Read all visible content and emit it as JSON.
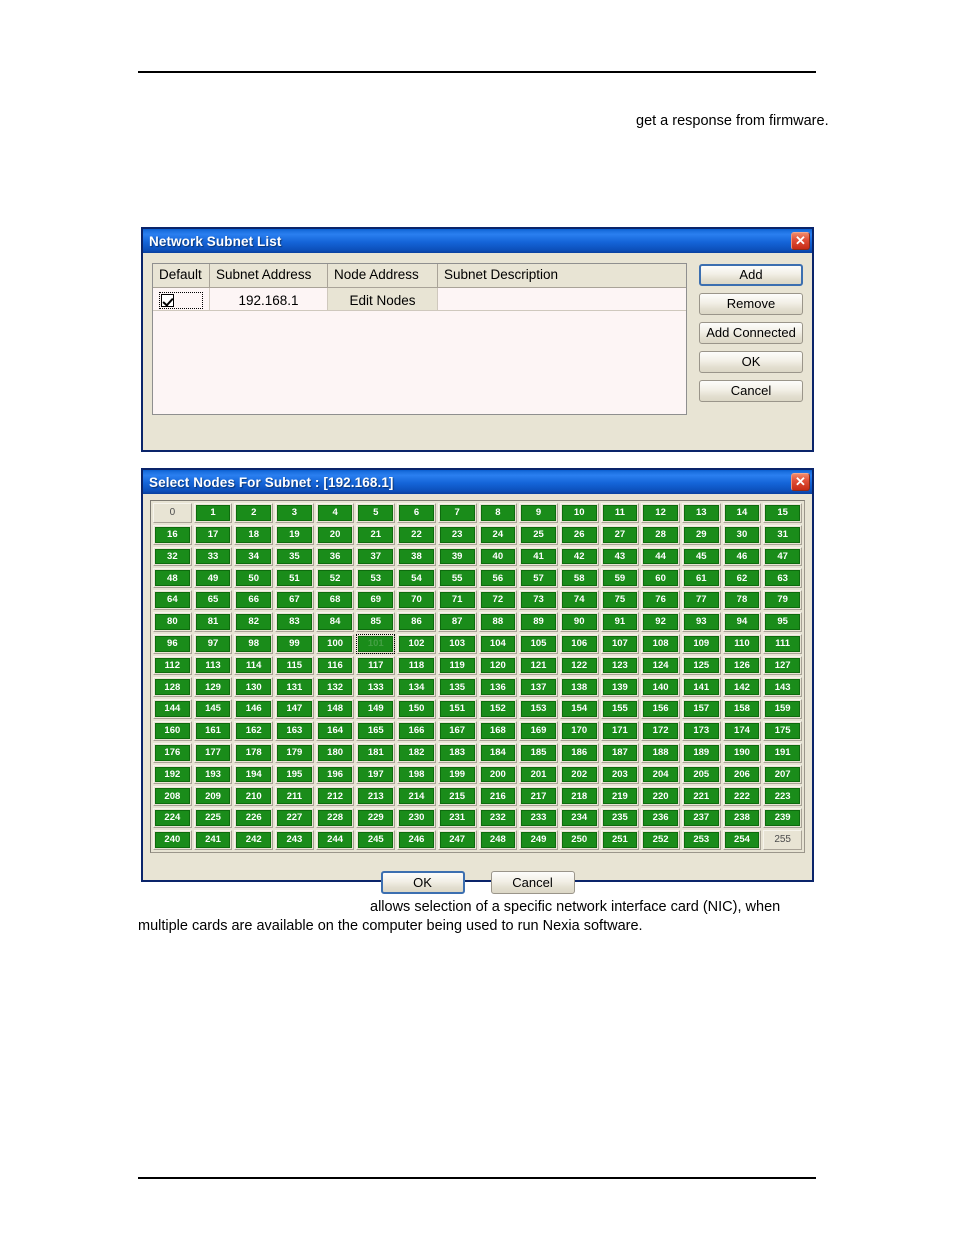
{
  "document": {
    "snippet_top": "get a response from firmware.",
    "body_paragraph": "allows selection of a specific network interface card (NIC), when multiple cards are available on the computer being used to run Nexia software."
  },
  "subnet_dialog": {
    "title": "Network Subnet List",
    "close_icon": "close-icon",
    "close_label": "✕",
    "columns": [
      "Default",
      "Subnet Address",
      "Node Address",
      "Subnet Description"
    ],
    "rows": [
      {
        "default_checked": true,
        "subnet_address": "192.168.1",
        "node_address": "Edit Nodes",
        "description": ""
      }
    ],
    "buttons": [
      {
        "label": "Add",
        "default": true
      },
      {
        "label": "Remove",
        "default": false
      },
      {
        "label": "Add Connected",
        "default": false
      },
      {
        "label": "OK",
        "default": false
      },
      {
        "label": "Cancel",
        "default": false
      }
    ]
  },
  "nodes_dialog": {
    "title": "Select Nodes For Subnet : [192.168.1]",
    "close_icon": "close-icon",
    "close_label": "✕",
    "grid": {
      "columns": 16,
      "rows": 16,
      "first_node": 0,
      "last_node": 255,
      "unselected_nodes": [
        0,
        255
      ],
      "focused_node": 101,
      "selected_color": "#1a8c1a",
      "unselected_color": "#e8e4d4"
    },
    "buttons": [
      {
        "label": "OK",
        "default": true
      },
      {
        "label": "Cancel",
        "default": false
      }
    ]
  }
}
